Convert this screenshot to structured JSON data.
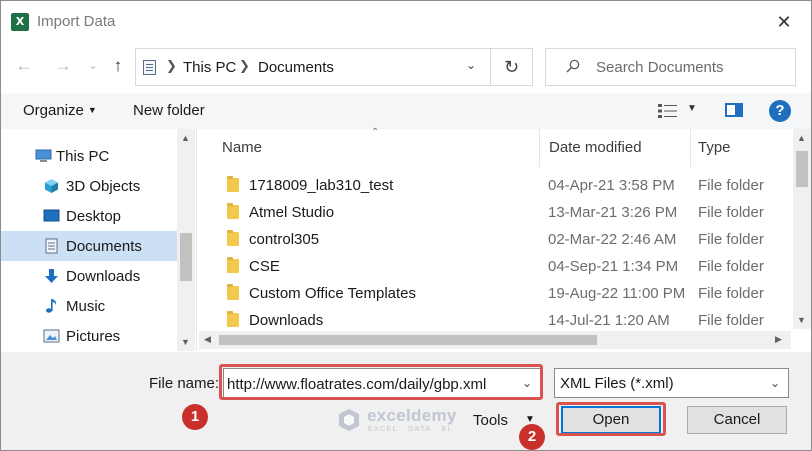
{
  "window": {
    "title": "Import Data",
    "app_icon": "excel-icon",
    "app_icon_letter": "X",
    "close_glyph": "✕"
  },
  "navigation": {
    "back_icon": "arrow-left-icon",
    "forward_icon": "arrow-right-icon",
    "recent_icon": "chevron-down-icon",
    "up_icon": "arrow-up-icon",
    "breadcrumbs": [
      "This PC",
      "Documents"
    ],
    "refresh_icon": "refresh-icon"
  },
  "search": {
    "placeholder": "Search Documents"
  },
  "toolbar": {
    "organize_label": "Organize",
    "new_folder_label": "New folder",
    "help_label": "?"
  },
  "sidebar": {
    "items": [
      {
        "label": "This PC",
        "icon": "computer-icon",
        "selected": false
      },
      {
        "label": "3D Objects",
        "icon": "cube-icon",
        "selected": false
      },
      {
        "label": "Desktop",
        "icon": "desktop-icon",
        "selected": false
      },
      {
        "label": "Documents",
        "icon": "document-icon",
        "selected": true
      },
      {
        "label": "Downloads",
        "icon": "download-icon",
        "selected": false
      },
      {
        "label": "Music",
        "icon": "music-icon",
        "selected": false
      },
      {
        "label": "Pictures",
        "icon": "picture-icon",
        "selected": false
      }
    ]
  },
  "file_list": {
    "columns": [
      "Name",
      "Date modified",
      "Type"
    ],
    "rows": [
      {
        "name": "1718009_lab310_test",
        "date": "04-Apr-21 3:58 PM",
        "type": "File folder"
      },
      {
        "name": "Atmel Studio",
        "date": "13-Mar-21 3:26 PM",
        "type": "File folder"
      },
      {
        "name": "control305",
        "date": "02-Mar-22 2:46 AM",
        "type": "File folder"
      },
      {
        "name": "CSE",
        "date": "04-Sep-21 1:34 PM",
        "type": "File folder"
      },
      {
        "name": "Custom Office Templates",
        "date": "19-Aug-22 11:00 PM",
        "type": "File folder"
      },
      {
        "name": "Downloads",
        "date": "14-Jul-21 1:20 AM",
        "type": "File folder"
      }
    ]
  },
  "bottom": {
    "file_name_label": "File name:",
    "file_name_value": "http://www.floatrates.com/daily/gbp.xml",
    "file_type_value": "XML Files (*.xml)",
    "tools_label": "Tools",
    "open_label": "Open",
    "cancel_label": "Cancel"
  },
  "annotations": {
    "step1": "1",
    "step2": "2",
    "highlight_color": "#d9534f"
  },
  "watermark": {
    "brand": "exceldemy",
    "tagline": "EXCEL · DATA · BI"
  }
}
